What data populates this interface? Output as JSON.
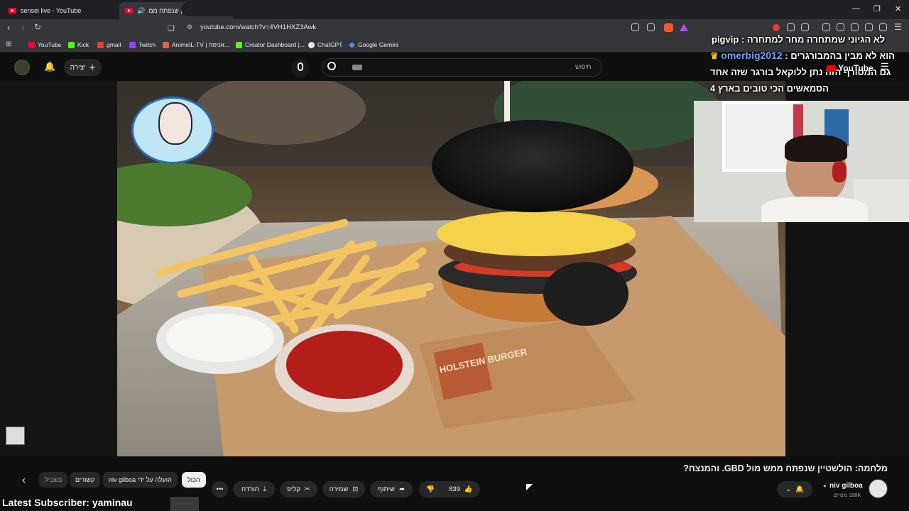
{
  "browser": {
    "tabs": [
      {
        "title": "sensei live - YouTube"
      },
      {
        "title": "מלחמה: הולשטיין שנפתח ממ"
      }
    ],
    "url": "youtube.com/watch?v=4VH1HXZ3Awk",
    "bookmarks": [
      "YouTube",
      "Kick",
      "gmail",
      "Twitch",
      "AnimeIL-TV | אנימה...",
      "Creator Dashboard |...",
      "ChatGPT",
      "Google Gemini"
    ]
  },
  "youtube": {
    "search_placeholder": "חיפוש",
    "create_label": "יצירה",
    "logo_text": "YouTube",
    "video_title": "מלחמה: הולשטיין שנפתח ממש מול GBD. והמנצח?",
    "channel_name": "niv gilboa",
    "subscribers": "188K מנויים",
    "likes": "839",
    "share_label": "שיתוף",
    "save_label": "שמירה",
    "clip_label": "קליפ",
    "download_label": "הורדה",
    "chips": [
      "הכול",
      "הועלה על ידי niv gilboa",
      "קשורים",
      "בשביל"
    ],
    "product_text": "HOLSTEIN BURGER"
  },
  "stream_overlay": {
    "chat_line1": "לא הגיוני שמתחרה מחר למתחרה : pigvip",
    "chat_user": "omerbig2012",
    "chat_line2": "הוא לא מבין בהמבורגרים :",
    "chat_line3": "גם המסורף הזה נתן ללוקאל בורגר שזה אחד",
    "chat_line4": "הסמאשים הכי טובים בארץ 4",
    "latest_subscriber": "Latest Subscriber: yaminau"
  },
  "colors": {
    "accent": "#ff0033",
    "brand": "#ff0000"
  }
}
